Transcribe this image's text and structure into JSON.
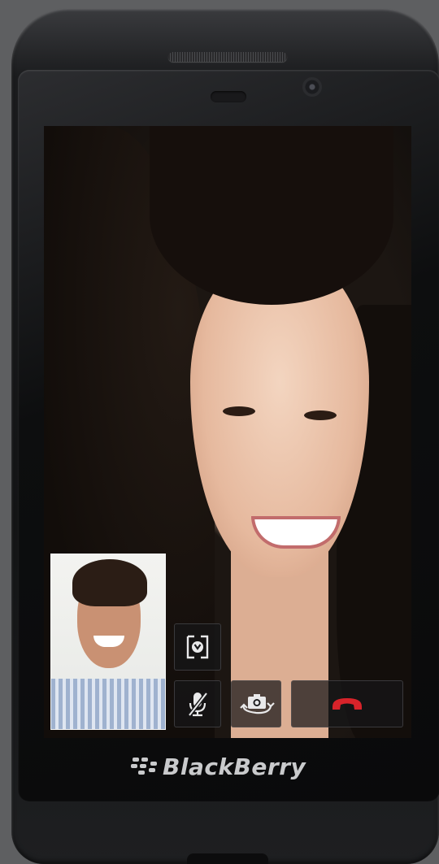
{
  "device": {
    "brand": "BlackBerry",
    "logo_icon": "blackberry-logo-icon"
  },
  "video_call": {
    "remote_video": "remote-caller-video",
    "self_view": "self-preview-video",
    "controls": [
      {
        "name": "toggle-self-view-button",
        "icon": "self-view-toggle-icon"
      },
      {
        "name": "mute-microphone-button",
        "icon": "mic-off-icon"
      },
      {
        "name": "switch-camera-button",
        "icon": "camera-switch-icon"
      },
      {
        "name": "end-call-button",
        "icon": "phone-hangup-icon",
        "color": "#d8232a"
      }
    ]
  },
  "colors": {
    "end_call": "#d8232a",
    "icon": "#e9e9ea",
    "phone_body": "#141516"
  }
}
